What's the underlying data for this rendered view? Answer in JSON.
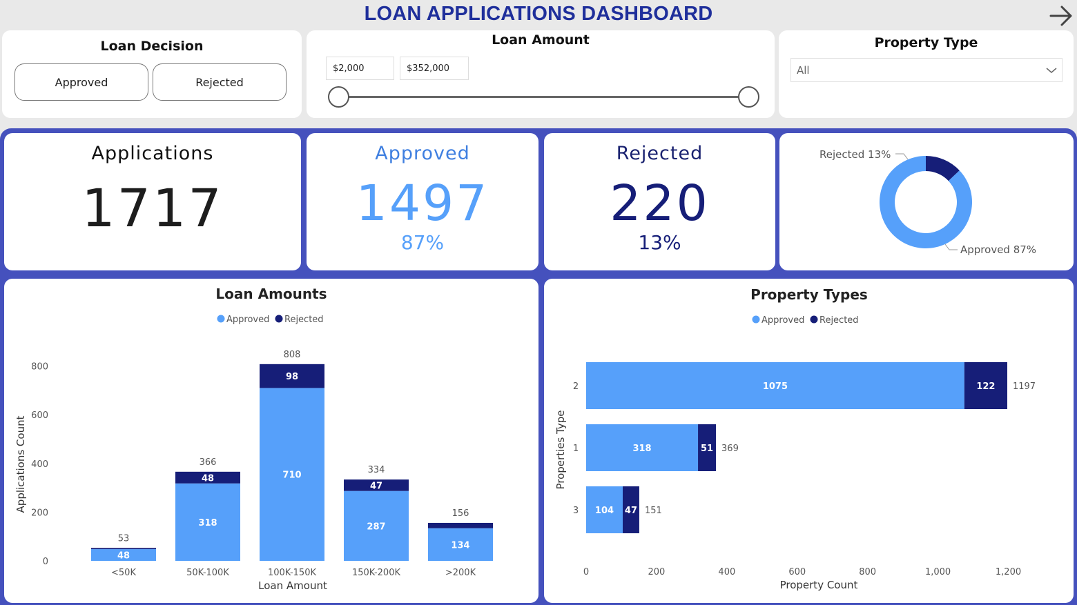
{
  "header": {
    "title": "LOAN APPLICATIONS DASHBOARD"
  },
  "filters": {
    "decision": {
      "title": "Loan Decision",
      "options": [
        "Approved",
        "Rejected"
      ]
    },
    "amount": {
      "title": "Loan Amount",
      "min": "$2,000",
      "max": "$352,000"
    },
    "property": {
      "title": "Property Type",
      "selected": "All"
    }
  },
  "kpis": {
    "applications": {
      "title": "Applications",
      "value": "1717"
    },
    "approved": {
      "title": "Approved",
      "value": "1497",
      "pct": "87%"
    },
    "rejected": {
      "title": "Rejected",
      "value": "220",
      "pct": "13%"
    }
  },
  "colors": {
    "approved": "#56a0fa",
    "rejected": "#161e78",
    "band": "#4551bd",
    "title": "#1f2f9b"
  },
  "chart_data": [
    {
      "type": "pie",
      "variant": "donut",
      "labels": [
        "Rejected",
        "Approved"
      ],
      "values": [
        13,
        87
      ],
      "data_labels": [
        "Rejected 13%",
        "Approved 87%"
      ]
    },
    {
      "type": "bar",
      "stacked": true,
      "title": "Loan Amounts",
      "xlabel": "Loan Amount",
      "ylabel": "Applications Count",
      "categories": [
        "<50K",
        "50K-100K",
        "100K-150K",
        "150K-200K",
        ">200K"
      ],
      "series": [
        {
          "name": "Approved",
          "values": [
            48,
            318,
            710,
            287,
            134
          ]
        },
        {
          "name": "Rejected",
          "values": [
            5,
            48,
            98,
            47,
            22
          ]
        }
      ],
      "totals": [
        53,
        366,
        808,
        334,
        156
      ],
      "ylim": [
        0,
        850
      ],
      "yticks": [
        0,
        200,
        400,
        600,
        800
      ],
      "legend": "top-center"
    },
    {
      "type": "bar",
      "orientation": "horizontal",
      "stacked": true,
      "title": "Property Types",
      "xlabel": "Property Count",
      "ylabel": "Properties Type",
      "categories": [
        "2",
        "1",
        "3"
      ],
      "series": [
        {
          "name": "Approved",
          "values": [
            1075,
            318,
            104
          ]
        },
        {
          "name": "Rejected",
          "values": [
            122,
            51,
            47
          ]
        }
      ],
      "totals": [
        1197,
        369,
        151
      ],
      "xlim": [
        0,
        1250
      ],
      "xticks": [
        0,
        200,
        400,
        600,
        800,
        "1,000",
        "1,200"
      ],
      "legend": "top-center"
    }
  ]
}
